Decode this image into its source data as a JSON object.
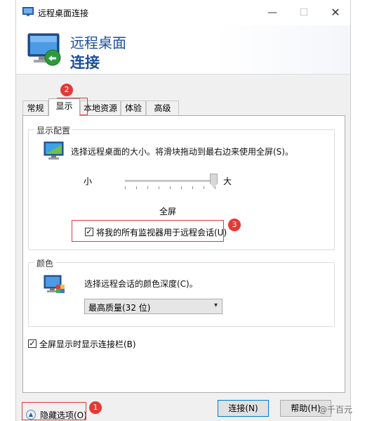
{
  "window": {
    "title": "远程桌面连接"
  },
  "banner": {
    "line1": "远程桌面",
    "line2": "连接"
  },
  "tabs": [
    "常规",
    "显示",
    "本地资源",
    "体验",
    "高级"
  ],
  "active_tab": "显示",
  "display_config": {
    "group_label": "显示配置",
    "description": "选择远程桌面的大小。将滑块拖动到最右边来使用全屏(S)。",
    "slider_min_label": "小",
    "slider_max_label": "大",
    "slider_value_label": "全屏",
    "slider_position": 1.0,
    "all_monitors_label": "将我的所有监视器用于远程会话(U)",
    "all_monitors_checked": true
  },
  "colors": {
    "group_label": "颜色",
    "description": "选择远程会话的颜色深度(C)。",
    "selected": "最高质量(32 位)"
  },
  "fullscreen_bar": {
    "label": "全屏显示时显示连接栏(B)",
    "checked": true
  },
  "footer": {
    "hide_options": "隐藏选项(O)",
    "connect": "连接(N)",
    "help": "帮助(H)"
  },
  "callouts": [
    "1",
    "2",
    "3"
  ],
  "watermark": "@千百元",
  "accent_color": "#1b4f9c",
  "callout_color": "#e53935"
}
